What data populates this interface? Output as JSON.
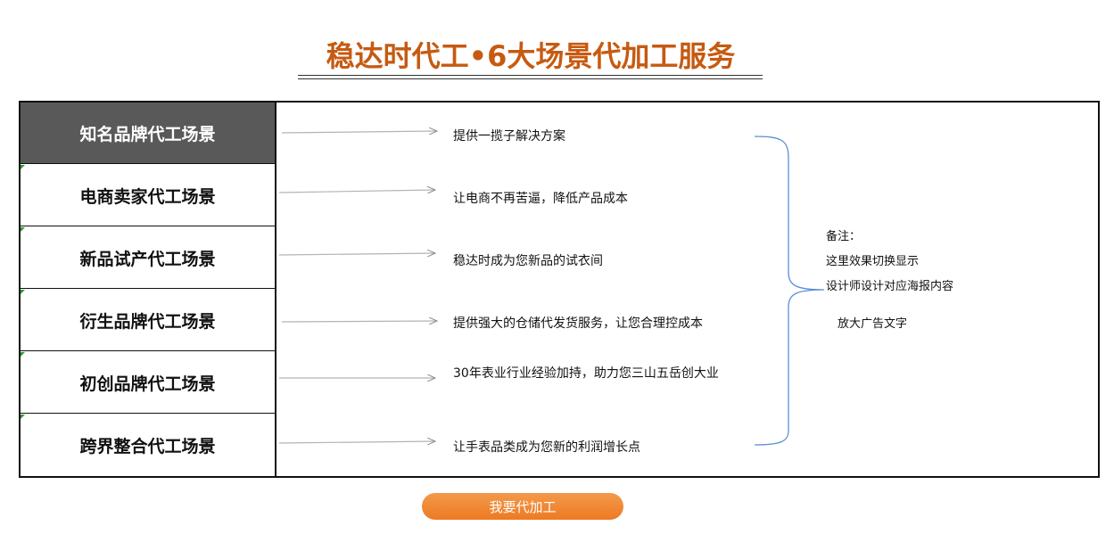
{
  "title": "稳达时代工•6大场景代加工服务",
  "scenes": [
    {
      "label": "知名品牌代工场景",
      "desc": "提供一揽子解决方案",
      "active": true
    },
    {
      "label": "电商卖家代工场景",
      "desc": "让电商不再苦逼，降低产品成本",
      "active": false
    },
    {
      "label": "新品试产代工场景",
      "desc": "稳达时成为您新品的试衣间",
      "active": false
    },
    {
      "label": "衍生品牌代工场景",
      "desc": "提供强大的仓储代发货服务，让您合理控成本",
      "active": false
    },
    {
      "label": "初创品牌代工场景",
      "desc": "30年表业行业经验加持，助力您三山五岳创大业",
      "active": false
    },
    {
      "label": "跨界整合代工场景",
      "desc": "让手表品类成为您新的利润增长点",
      "active": false
    }
  ],
  "notes": {
    "heading": "备注：",
    "line1": "这里效果切换显示",
    "line2": "设计师设计对应海报内容",
    "line3": "放大广告文字"
  },
  "cta_label": "我要代加工",
  "colors": {
    "title": "#c65a11",
    "active_scene_bg": "#595959",
    "cta": "#ee7a24",
    "brace": "#5b8fd6",
    "arrow": "#999999"
  },
  "icons": {
    "arrow": "right-arrow-icon",
    "brace": "right-curly-brace-icon"
  }
}
